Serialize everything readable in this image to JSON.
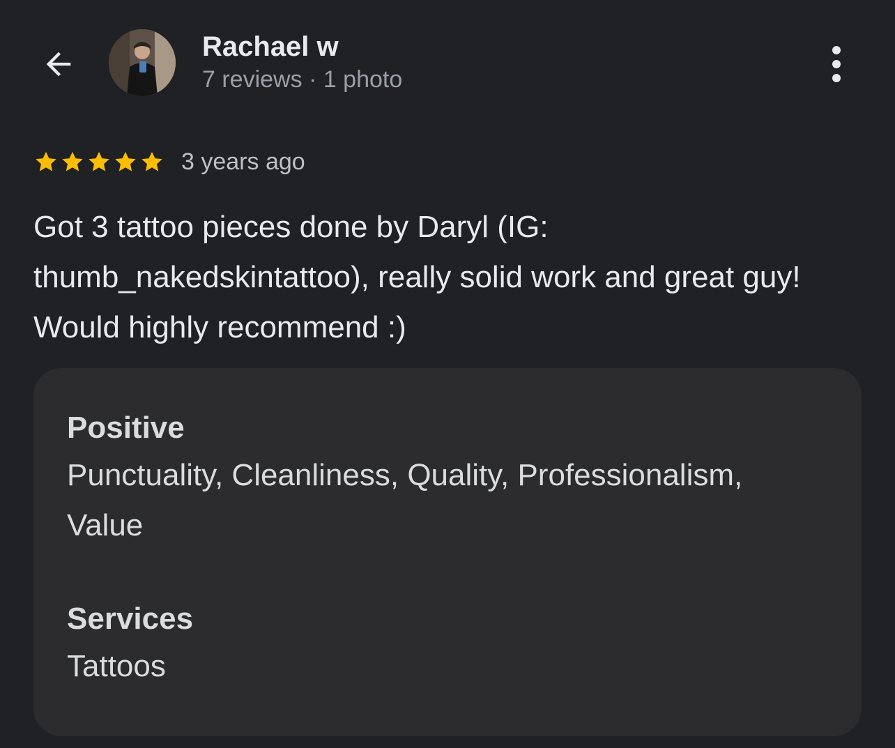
{
  "header": {
    "reviewer_name": "Rachael w",
    "reviewer_meta": "7 reviews · 1 photo",
    "back_icon": "arrow-back-icon",
    "more_icon": "more-vert-icon"
  },
  "review": {
    "rating": 5,
    "max_rating": 5,
    "date": "3 years ago",
    "text": "Got 3 tattoo pieces done by Daryl (IG: thumb_nakedskintattoo), really solid work and great guy! Would highly recommend :)"
  },
  "attributes": {
    "positive_heading": "Positive",
    "positive_value": "Punctuality, Cleanliness, Quality, Professionalism, Value",
    "services_heading": "Services",
    "services_value": "Tattoos"
  },
  "colors": {
    "background": "#202124",
    "card": "#2c2c2e",
    "star": "#fbbc04",
    "secondary_text": "#9aa0a6"
  }
}
